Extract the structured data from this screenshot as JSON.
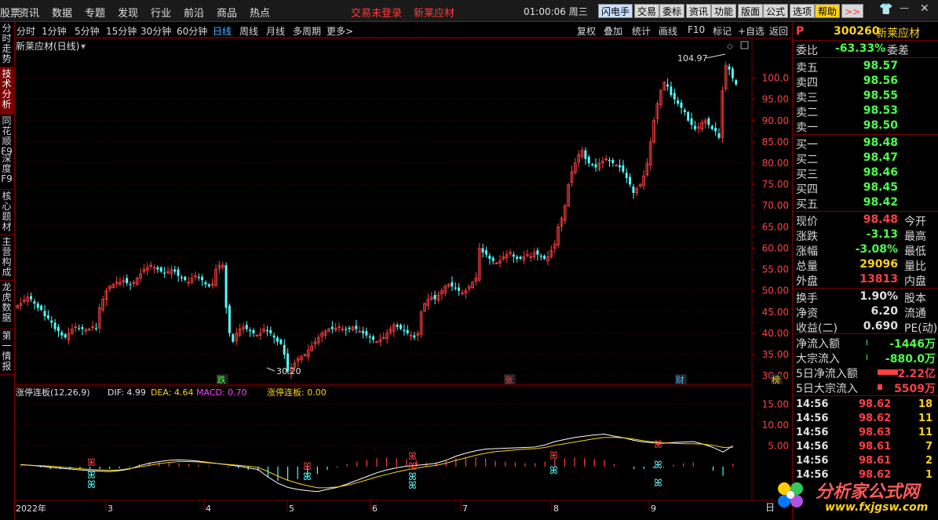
{
  "menubar": {
    "items": [
      "股票",
      "资讯",
      "数据",
      "专题",
      "发现",
      "行业",
      "前沿",
      "商品",
      "热点"
    ],
    "alerts": [
      "交易未登录",
      "新莱应材"
    ],
    "clock": "01:00:06 周三",
    "buttons": [
      "闪电手",
      "交易",
      "委标",
      "资讯",
      "功能",
      "版面",
      "公式",
      "选项",
      "帮助"
    ],
    "more": ">>"
  },
  "sidetabs": [
    "分时走势",
    "技术分析",
    "同花顺F9",
    "深度F9",
    "核心题材",
    "主营构成",
    "龙虎数据",
    "第一情报"
  ],
  "periods": [
    "分时",
    "1分钟",
    "5分钟",
    "15分钟",
    "30分钟",
    "60分钟",
    "日线",
    "周线",
    "月线",
    "多周期",
    "更多>"
  ],
  "active_period": "日线",
  "tools": [
    "复权",
    "叠加",
    "统计",
    "画线",
    "F10",
    "标记",
    "+自选",
    "返回"
  ],
  "main_title": "新莱应材(日线)",
  "indicator": {
    "name": "涨停连板(12,26,9)",
    "dif": "DIF: 4.99",
    "dea": "DEA: 4.64",
    "macd": "MACD: 0.70",
    "lb": "涨停连板: 0.00"
  },
  "max_label": "104.97",
  "min_label": "30.20",
  "events": [
    {
      "label": "跌",
      "color": "#4cff4c",
      "slot": 60
    },
    {
      "label": "张",
      "color": "#ff4040",
      "slot": 144
    },
    {
      "label": "财",
      "color": "#49b3ff",
      "slot": 194
    },
    {
      "label": "榜",
      "color": "#ffd21a",
      "slot": 222
    }
  ],
  "x_labels": [
    "2022年",
    "3",
    "4",
    "5",
    "6",
    "7",
    "8",
    "9"
  ],
  "y_axis": [
    "100.0",
    "95.00",
    "90.00",
    "85.00",
    "80.00",
    "75.00",
    "70.00",
    "65.00",
    "60.00",
    "55.00",
    "50.00",
    "45.00",
    "40.00",
    "35.00",
    "30.00"
  ],
  "sub_y_axis": [
    "15.00",
    "10.00",
    "5.00"
  ],
  "corner_label": "日",
  "chart_data": {
    "type": "candlestick",
    "stock": "新莱应材",
    "ylim": [
      28,
      106
    ],
    "closes": [
      46.5,
      47,
      47.8,
      48.5,
      48,
      47,
      46,
      45.5,
      44,
      43.5,
      42.5,
      41,
      40.5,
      39.5,
      39,
      40,
      41,
      41.5,
      41.2,
      41,
      40.8,
      41,
      41.5,
      41,
      46,
      48,
      50,
      51,
      51.5,
      52,
      52,
      52.5,
      51.8,
      51.5,
      52,
      53,
      54,
      55,
      55.5,
      56,
      55.5,
      55,
      54.5,
      54,
      54.5,
      55,
      54.5,
      53.5,
      53,
      52.5,
      52,
      53,
      53.5,
      53,
      52.5,
      51.5,
      51,
      51.5,
      55,
      56,
      56,
      46,
      40,
      38,
      40,
      41,
      41.5,
      41,
      40.5,
      40,
      39.5,
      40,
      41,
      40.5,
      40,
      39,
      38,
      37.5,
      35,
      31,
      32,
      33,
      34,
      34.5,
      35,
      36,
      37,
      38,
      39,
      40,
      40.5,
      41,
      41,
      41.2,
      41.5,
      41,
      40.8,
      41,
      41.5,
      41,
      40.5,
      40,
      39.5,
      39,
      38.5,
      38,
      38.5,
      39,
      40,
      41,
      42,
      41.5,
      41,
      40.5,
      40,
      39.5,
      39,
      40,
      45,
      47,
      48,
      48.5,
      48,
      49,
      50,
      51,
      51.5,
      51,
      50.5,
      50,
      49.5,
      50,
      51,
      52,
      53,
      60,
      59,
      58.5,
      57.5,
      57,
      56.5,
      57,
      58,
      58.5,
      59,
      58,
      57.5,
      57.5,
      58,
      58.5,
      58,
      59,
      58.5,
      58,
      57.5,
      58,
      59.5,
      61,
      65,
      67,
      70,
      75,
      78,
      80,
      82,
      83,
      81,
      80,
      79.5,
      79,
      80,
      80.5,
      81,
      80.5,
      80,
      79.5,
      79,
      78,
      76.5,
      75,
      73,
      74,
      75,
      77,
      80,
      85,
      90,
      94,
      97,
      99,
      98,
      96,
      95,
      94,
      93,
      92,
      90,
      89,
      88,
      88.5,
      89.5,
      90,
      89,
      88,
      87.5,
      86,
      97,
      103,
      102,
      100,
      98.48
    ]
  },
  "macd_data": {
    "dif": [
      0.5,
      0.3,
      0.1,
      -0.2,
      -0.4,
      -0.6,
      -0.8,
      -1.0,
      -1.1,
      -1.2,
      -1.0,
      -0.6,
      0.2,
      0.8,
      1.2,
      1.5,
      1.6,
      1.5,
      1.3,
      1.0,
      0.7,
      0.4,
      0.1,
      -0.3,
      -0.7,
      -2.5,
      -4,
      -5,
      -5.5,
      -5.8,
      -6,
      -5.5,
      -5,
      -4.2,
      -3.3,
      -2.4,
      -1.5,
      -0.8,
      -0.3,
      0.1,
      0.3,
      0.5,
      0.8,
      1.5,
      2.5,
      3.2,
      3.8,
      4.2,
      4.3,
      4.4,
      4.5,
      4.6,
      4.7,
      5.2,
      6,
      6.5,
      7,
      7.3,
      7.6,
      7.8,
      7.3,
      6.9,
      6.3,
      5.9,
      5.7,
      5.6,
      5.8,
      5.9,
      6,
      5.4,
      4.6,
      3.5,
      4.99
    ],
    "dea": [
      0.4,
      0.3,
      0.2,
      0.1,
      -0.1,
      -0.3,
      -0.5,
      -0.7,
      -0.8,
      -0.9,
      -0.8,
      -0.5,
      -0.1,
      0.3,
      0.7,
      1.0,
      1.2,
      1.2,
      1.1,
      0.9,
      0.7,
      0.5,
      0.3,
      0.1,
      -0.2,
      -1.2,
      -2.3,
      -3.3,
      -4,
      -4.6,
      -5.1,
      -5.1,
      -4.9,
      -4.5,
      -3.9,
      -3.2,
      -2.5,
      -1.9,
      -1.3,
      -0.8,
      -0.4,
      0,
      0.3,
      0.8,
      1.5,
      2.1,
      2.7,
      3.2,
      3.6,
      3.8,
      4.0,
      4.2,
      4.3,
      4.6,
      5.1,
      5.5,
      5.9,
      6.3,
      6.7,
      7,
      7,
      6.9,
      6.6,
      6.2,
      5.9,
      5.7,
      5.6,
      5.5,
      5.5,
      5.4,
      5.1,
      4.6,
      4.64
    ]
  },
  "quote": {
    "code": "300260",
    "name": "新莱应材",
    "ratio_label": "委比",
    "ratio": "-63.33%",
    "ratio_diff": "委差",
    "asks": [
      {
        "l": "卖五",
        "p": "98.57"
      },
      {
        "l": "卖四",
        "p": "98.56"
      },
      {
        "l": "卖三",
        "p": "98.55"
      },
      {
        "l": "卖二",
        "p": "98.53"
      },
      {
        "l": "卖一",
        "p": "98.50"
      }
    ],
    "bids": [
      {
        "l": "买一",
        "p": "98.48"
      },
      {
        "l": "买二",
        "p": "98.47"
      },
      {
        "l": "买三",
        "p": "98.46"
      },
      {
        "l": "买四",
        "p": "98.45"
      },
      {
        "l": "买五",
        "p": "98.42"
      }
    ],
    "stats": [
      {
        "l": "现价",
        "v": "98.48",
        "c": "#ff4040",
        "x": "今开"
      },
      {
        "l": "涨跌",
        "v": "-3.13",
        "c": "#4cff4c",
        "x": "最高"
      },
      {
        "l": "涨幅",
        "v": "-3.08%",
        "c": "#4cff4c",
        "x": "最低"
      },
      {
        "l": "总量",
        "v": "29096",
        "c": "#ffd21a",
        "x": "量比"
      },
      {
        "l": "外盘",
        "v": "13813",
        "c": "#ff4040",
        "x": "内盘"
      }
    ],
    "stats2": [
      {
        "l": "换手",
        "v": "1.90%",
        "c": "#e0e0e0",
        "x": "股本"
      },
      {
        "l": "净资",
        "v": "6.20",
        "c": "#e0e0e0",
        "x": "流通"
      },
      {
        "l": "收益(二)",
        "v": "0.690",
        "c": "#e0e0e0",
        "x": "PE(动)"
      }
    ],
    "flow": [
      {
        "l": "净流入额",
        "v": "-1446万",
        "c": "#4cff4c"
      },
      {
        "l": "大宗流入",
        "v": "-880.0万",
        "c": "#4cff4c"
      },
      {
        "l": "5日净流入额",
        "v": "2.22亿",
        "c": "#ff4040"
      },
      {
        "l": "5日大宗流入",
        "v": "5509万",
        "c": "#ff4040"
      }
    ],
    "ticks": [
      {
        "t": "14:56",
        "p": "98.62",
        "v": "18"
      },
      {
        "t": "14:56",
        "p": "98.62",
        "v": "11"
      },
      {
        "t": "14:56",
        "p": "98.63",
        "v": "11"
      },
      {
        "t": "14:56",
        "p": "98.61",
        "v": "7"
      },
      {
        "t": "14:56",
        "p": "98.61",
        "v": "2"
      },
      {
        "t": "14:56",
        "p": "98.62",
        "v": "1"
      }
    ]
  },
  "watermark": {
    "text": "分析家公式网",
    "url": "www.fxjgsw.com"
  }
}
